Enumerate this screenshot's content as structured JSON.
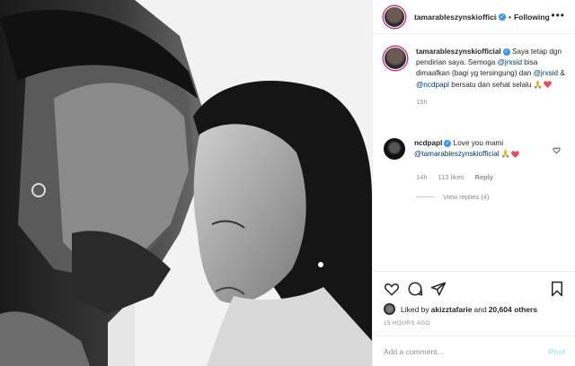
{
  "header": {
    "username": "tamarableszynskiofficial",
    "separator": "•",
    "follow_label": "Following",
    "more_icon": "more-horizontal-icon"
  },
  "caption": {
    "username": "tamarableszynskiofficial",
    "text_1": "Saya tetap dgn pendirian saya. Semoga ",
    "mention_1": "@jrxsid",
    "text_2": " bisa dimaafkan (bagi yg tersingung) dan ",
    "mention_2": "@jrxsid",
    "text_3": " & ",
    "mention_3": "@ncdpapl",
    "text_4": " bersatu dan sehat selalu ",
    "emoji": "🙏",
    "time": "15h"
  },
  "comment": {
    "username": "ncdpapl",
    "text": "Love you mami ",
    "mention": "@tamarableszynskiofficial",
    "emoji": "🙏",
    "time": "14h",
    "likes": "113 likes",
    "reply_label": "Reply",
    "view_replies": "View replies (4)"
  },
  "likes": {
    "text_1": "Liked by ",
    "user": "akizztafarie",
    "text_2": " and ",
    "count": "20,604 others"
  },
  "timestamp": "15 HOURS AGO",
  "add_comment": {
    "placeholder": "Add a comment...",
    "post_label": "Post"
  },
  "colors": {
    "heart": "#ed4956",
    "verified": "#3897f0",
    "mention": "#00376b",
    "post_disabled": "#b2dffc"
  }
}
